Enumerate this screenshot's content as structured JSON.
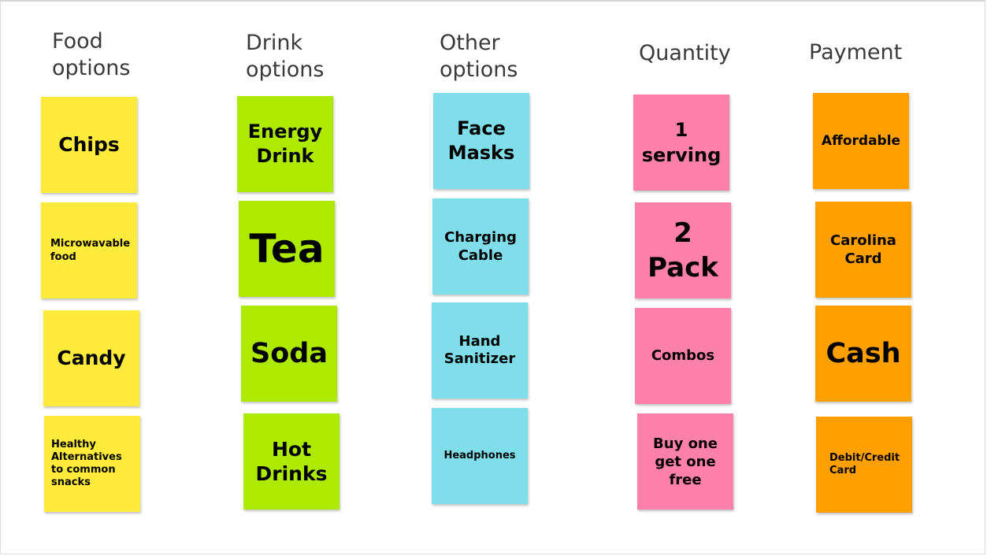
{
  "columns": [
    {
      "title": "Food\noptions",
      "color": "#ffeb3b",
      "notes": [
        "Chips",
        "Microwavable food",
        "Candy",
        "Healthy Alternatives to common snacks"
      ]
    },
    {
      "title": "Drink\noptions",
      "color": "#adea00",
      "notes": [
        "Energy Drink",
        "Tea",
        "Soda",
        "Hot Drinks"
      ]
    },
    {
      "title": "Other\noptions",
      "color": "#80deea",
      "notes": [
        "Face Masks",
        "Charging Cable",
        "Hand Sanitizer",
        "Headphones"
      ]
    },
    {
      "title": "Quantity",
      "color": "#ff80ab",
      "notes": [
        "1 serving",
        "2 Pack",
        "Combos",
        "Buy one get one free"
      ]
    },
    {
      "title": "Payment",
      "color": "#ffa000",
      "notes": [
        "Affordable",
        "Carolina Card",
        "Cash",
        "Debit/Credit Card"
      ]
    }
  ]
}
